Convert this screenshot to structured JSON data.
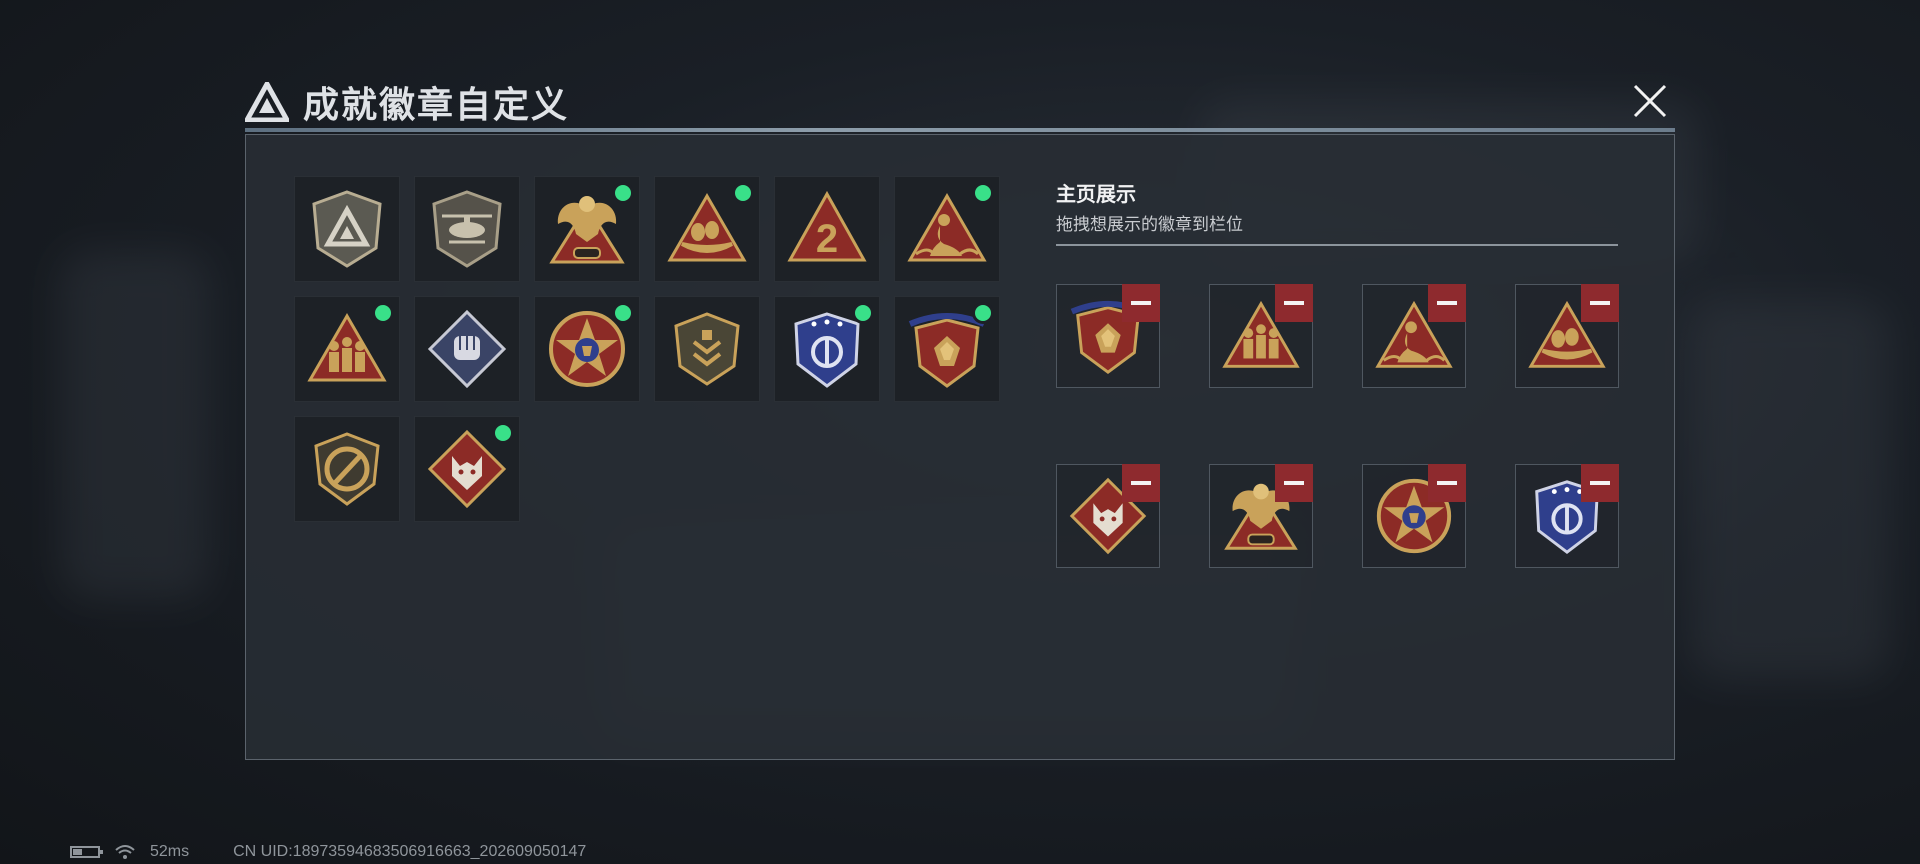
{
  "header": {
    "title": "成就徽章自定义",
    "close_icon": "close-icon"
  },
  "badge_grid": {
    "badges": [
      {
        "icon": "triangle-logo-shield-badge",
        "new": false
      },
      {
        "icon": "helicopter-shield-badge",
        "new": false
      },
      {
        "icon": "phoenix-crest-badge",
        "new": true
      },
      {
        "icon": "eggs-nest-triangle-badge",
        "new": true
      },
      {
        "icon": "number-two-triangle-badge",
        "new": false
      },
      {
        "icon": "mermaid-triangle-badge",
        "new": true
      },
      {
        "icon": "soldiers-triangle-badge",
        "new": true
      },
      {
        "icon": "fist-diamond-badge",
        "new": false
      },
      {
        "icon": "star-emblem-badge",
        "new": true
      },
      {
        "icon": "chevron-shield-badge",
        "new": false
      },
      {
        "icon": "blue-shield-badge",
        "new": true
      },
      {
        "icon": "crown-shield-badge",
        "new": true
      },
      {
        "icon": "knife-shield-badge",
        "new": false
      },
      {
        "icon": "wolf-diamond-badge",
        "new": true
      }
    ]
  },
  "showcase": {
    "title": "主页展示",
    "subtitle": "拖拽想展示的徽章到栏位",
    "slots": [
      {
        "icon": "crown-shield-badge"
      },
      {
        "icon": "soldiers-triangle-badge"
      },
      {
        "icon": "mermaid-triangle-badge"
      },
      {
        "icon": "eggs-nest-triangle-badge"
      },
      {
        "icon": "wolf-diamond-badge"
      },
      {
        "icon": "phoenix-crest-badge"
      },
      {
        "icon": "star-emblem-badge"
      },
      {
        "icon": "blue-shield-badge"
      }
    ]
  },
  "footer": {
    "ping": "52ms",
    "uid": "CN UID:18973594683506916663_202609050147"
  },
  "colors": {
    "new_dot": "#39e089",
    "remove_button": "#8e2a2e",
    "gold": "#c9a25a",
    "red": "#8c2b26",
    "blue": "#2f3f8c"
  }
}
